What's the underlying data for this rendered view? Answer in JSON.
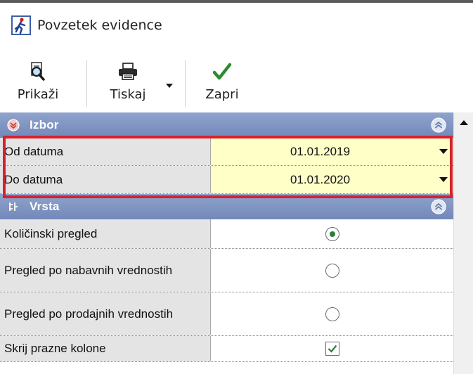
{
  "window": {
    "title": "Povzetek evidence"
  },
  "toolbar": {
    "buttons": [
      {
        "label": "Prikaži",
        "icon": "magnifier-document-icon"
      },
      {
        "label": "Tiskaj",
        "icon": "printer-icon"
      },
      {
        "label": "Zapri",
        "icon": "checkmark-icon"
      }
    ]
  },
  "grid": {
    "categories": [
      {
        "label": "Izbor",
        "rows": [
          {
            "name": "Od datuma",
            "value": "01.01.2019"
          },
          {
            "name": "Do datuma",
            "value": "01.01.2020"
          }
        ]
      },
      {
        "label": "Vrsta",
        "rows": [
          {
            "name": "Količinski pregled",
            "type": "radio",
            "selected": true
          },
          {
            "name": "Pregled po nabavnih vrednostih",
            "type": "radio",
            "selected": false
          },
          {
            "name": "Pregled po prodajnih vrednostih",
            "type": "radio",
            "selected": false
          },
          {
            "name": "Skrij prazne kolone",
            "type": "checkbox",
            "checked": true
          }
        ]
      }
    ]
  },
  "colors": {
    "category_header": "#7f94c3",
    "date_value_bg": "#ffffc8",
    "highlight_border": "#d6222e",
    "name_column_bg": "#e4e4e4"
  }
}
